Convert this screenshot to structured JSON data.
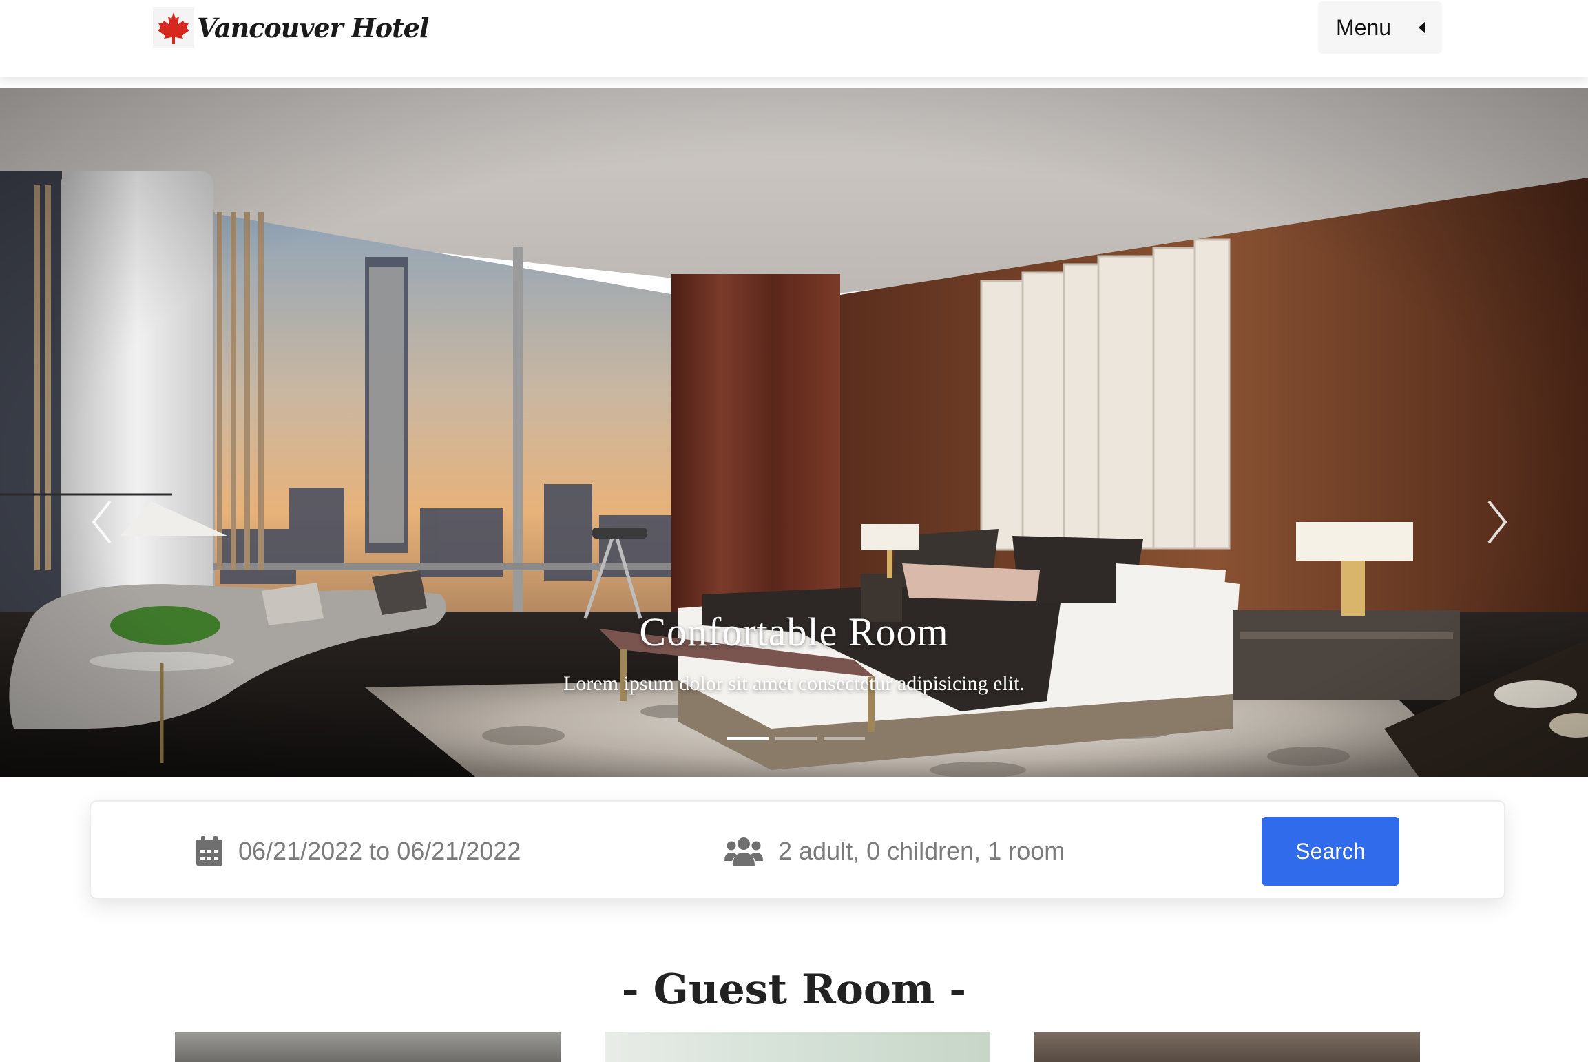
{
  "header": {
    "brand": "Vancouver Hotel",
    "menu_label": "Menu"
  },
  "hero": {
    "slide_title": "Confortable Room",
    "slide_subtitle": "Lorem ipsum dolor sit amet consectetur adipisicing elit.",
    "slide_count": 3,
    "active_slide": 1
  },
  "booking": {
    "dates": "06/21/2022 to 06/21/2022",
    "guests": "2 adult, 0 children, 1 room",
    "search_label": "Search"
  },
  "rooms": {
    "section_title": "- Guest Room -"
  },
  "colors": {
    "primary": "#2f6bea",
    "brand_leaf": "#d6281e"
  }
}
